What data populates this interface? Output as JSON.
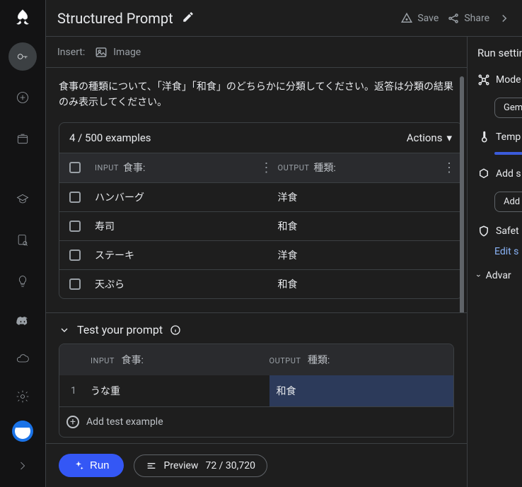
{
  "header": {
    "title": "Structured Prompt",
    "save_label": "Save",
    "share_label": "Share"
  },
  "insert": {
    "label": "Insert:",
    "image_label": "Image"
  },
  "prompt": {
    "text": "食事の種類について、「洋食」「和食」のどちらかに分類してください。返答は分類の結果のみ表示してください。"
  },
  "examples": {
    "count_label": "4 / 500 examples",
    "actions_label": "Actions",
    "input_prefix": "INPUT",
    "input_label": "食事:",
    "output_prefix": "OUTPUT",
    "output_label": "種類:",
    "rows": [
      {
        "input": "ハンバーグ",
        "output": "洋食"
      },
      {
        "input": "寿司",
        "output": "和食"
      },
      {
        "input": "ステーキ",
        "output": "洋食"
      },
      {
        "input": "天ぷら",
        "output": "和食"
      }
    ]
  },
  "test": {
    "heading": "Test your prompt",
    "input_prefix": "INPUT",
    "input_label": "食事:",
    "output_prefix": "OUTPUT",
    "output_label": "種類:",
    "rows": [
      {
        "num": "1",
        "input": "うな重",
        "output": "和食"
      }
    ],
    "add_label": "Add test example"
  },
  "runbar": {
    "run_label": "Run",
    "preview_label": "Preview",
    "token_count": "72 / 30,720"
  },
  "settings": {
    "title": "Run settin",
    "model_label": "Mode",
    "model_value": "Gem",
    "temp_label": "Temp",
    "add_label": "Add s",
    "add_button": "Add",
    "safety_label": "Safet",
    "safety_link": "Edit s",
    "advanced_label": "Advar"
  }
}
